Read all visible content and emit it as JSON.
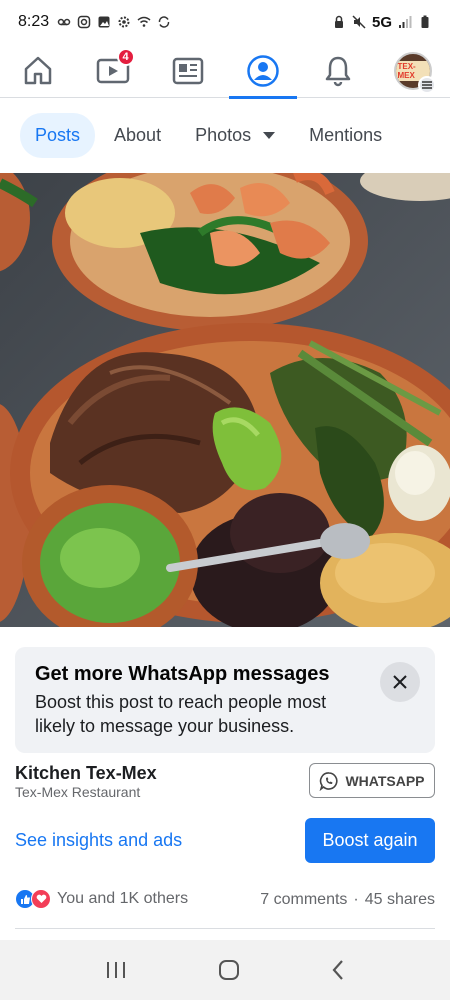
{
  "status_bar": {
    "time": "8:23",
    "network": "5G"
  },
  "navbar": {
    "items": [
      {
        "name": "home-icon"
      },
      {
        "name": "video-icon",
        "badge": "4"
      },
      {
        "name": "news-icon"
      },
      {
        "name": "profile-icon",
        "active": true
      },
      {
        "name": "bell-icon"
      },
      {
        "name": "avatar"
      }
    ],
    "avatar_label": "TEX-MEX",
    "accent_color": "#1877f2"
  },
  "tabs": [
    {
      "label": "Posts",
      "active": true
    },
    {
      "label": "About"
    },
    {
      "label": "Photos",
      "has_dropdown": true
    },
    {
      "label": "Mentions"
    }
  ],
  "promo": {
    "title": "Get more WhatsApp messages",
    "body": "Boost this post to reach people most likely to message your business."
  },
  "page": {
    "name": "Kitchen Tex-Mex",
    "category": "Tex-Mex Restaurant",
    "whatsapp_label": "WHATSAPP"
  },
  "actions": {
    "insights_label": "See insights and ads",
    "boost_label": "Boost again"
  },
  "engagement": {
    "reactions_text": "You and 1K others",
    "comments": "7 comments",
    "separator": "·",
    "shares": "45 shares"
  }
}
